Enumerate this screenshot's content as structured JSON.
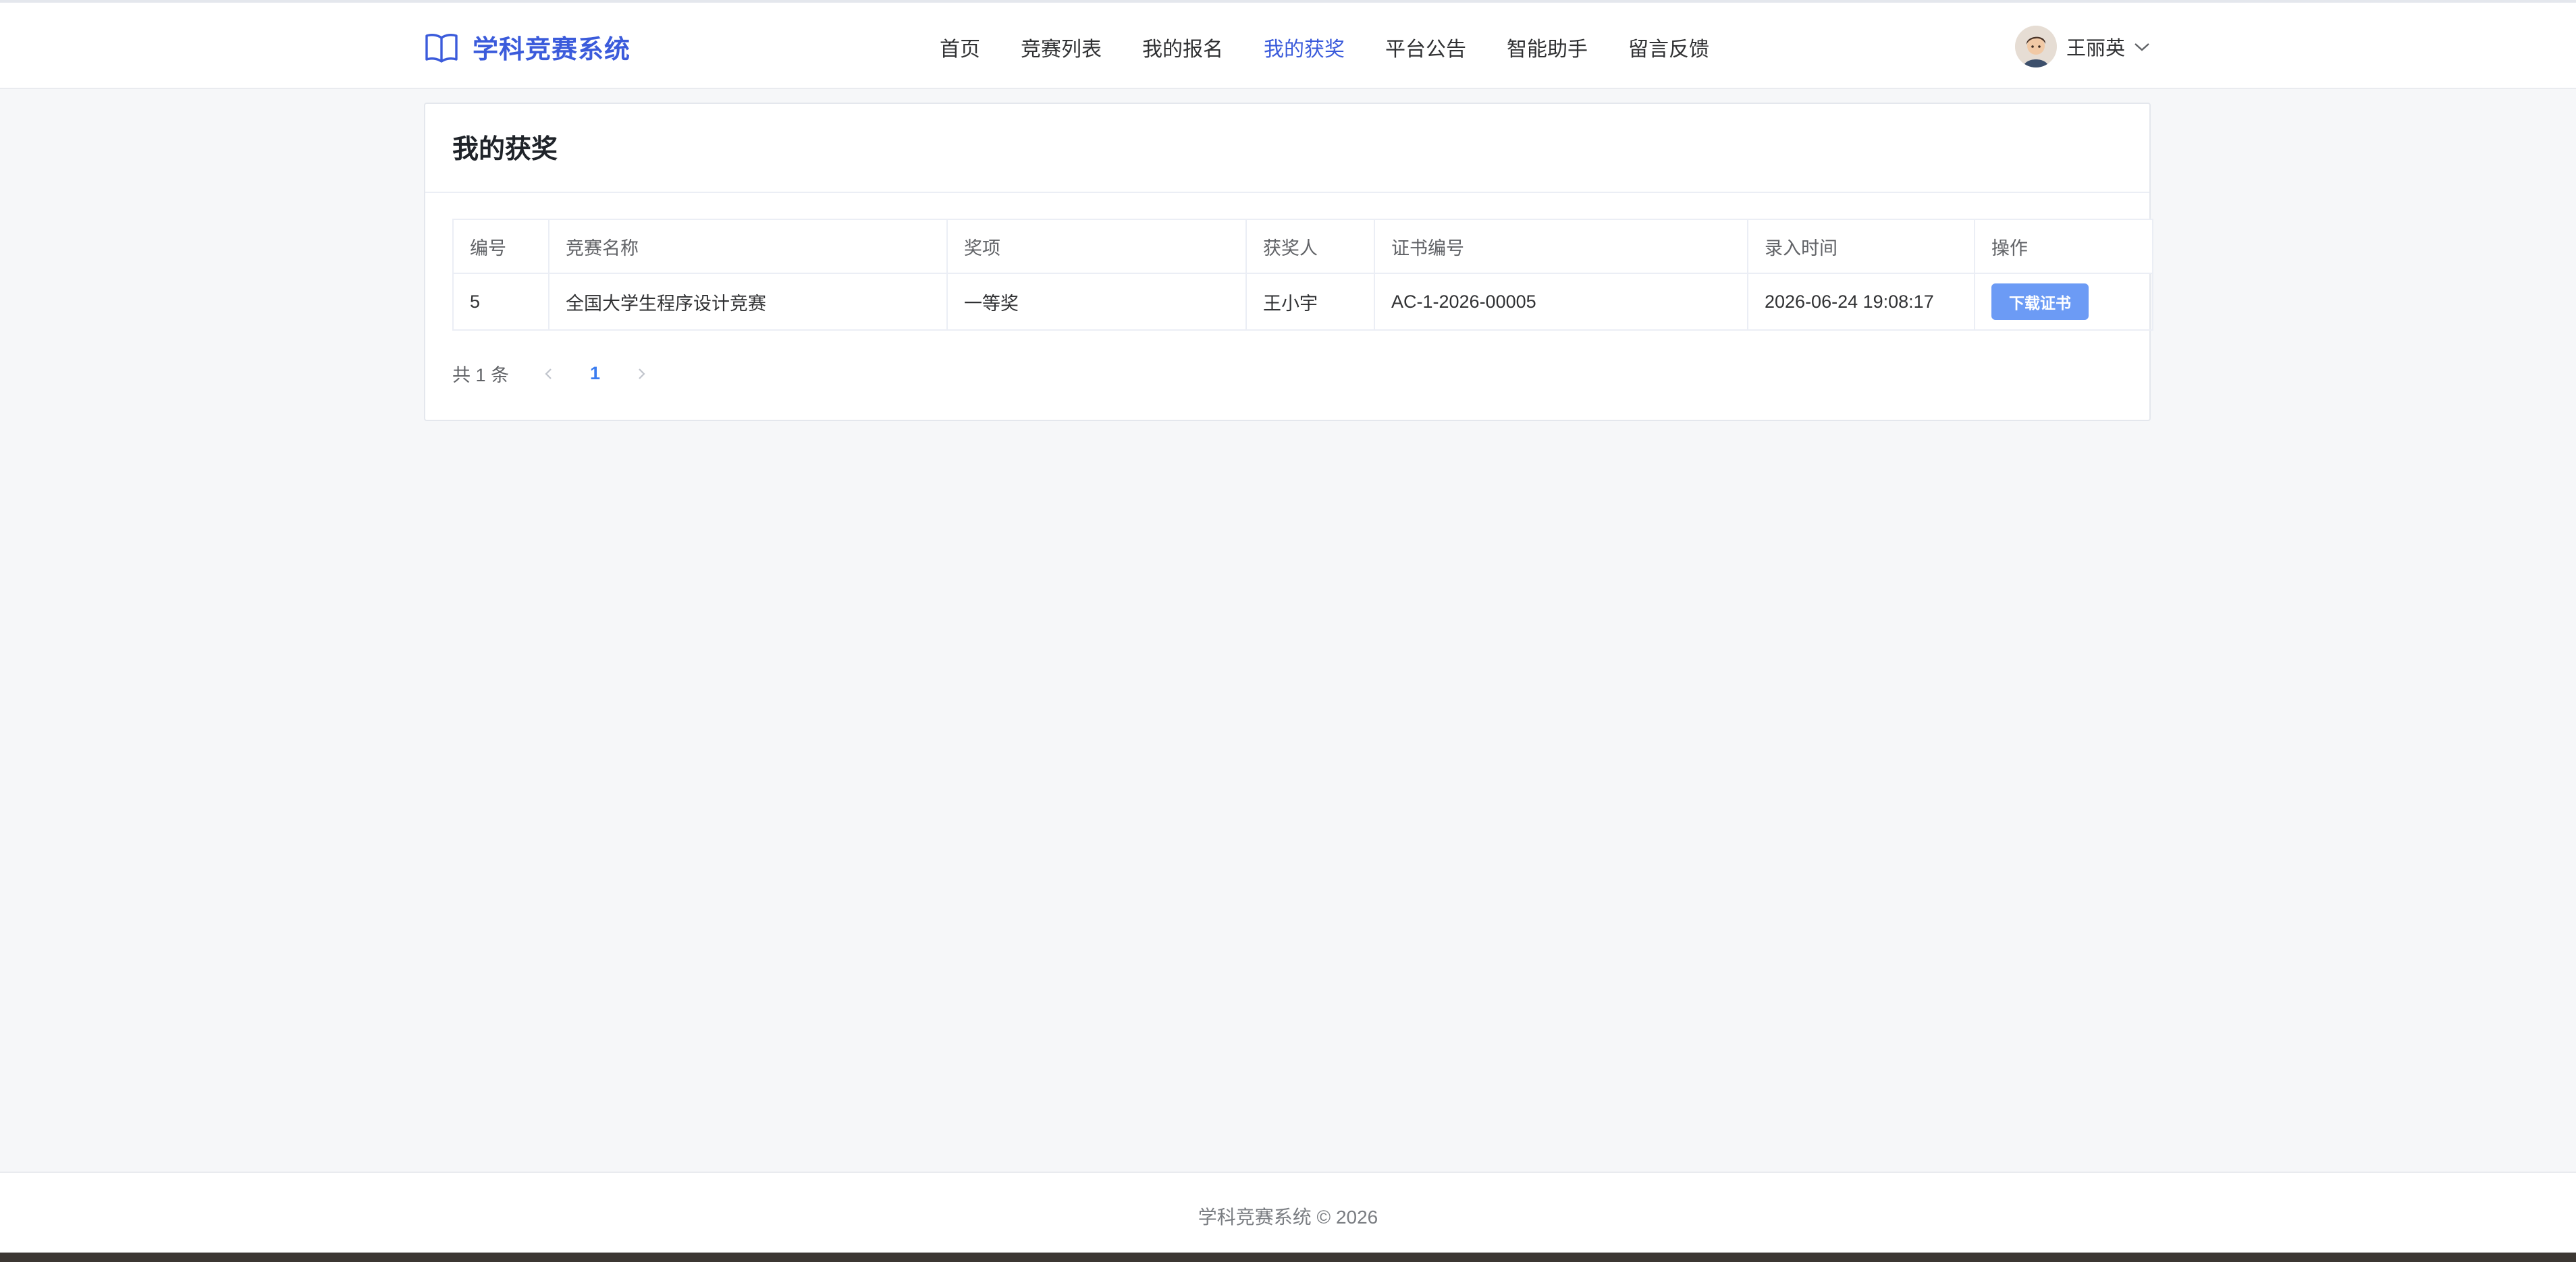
{
  "app": {
    "title": "学科竞赛系统"
  },
  "nav": {
    "items": [
      {
        "label": "首页"
      },
      {
        "label": "竞赛列表"
      },
      {
        "label": "我的报名"
      },
      {
        "label": "我的获奖"
      },
      {
        "label": "平台公告"
      },
      {
        "label": "智能助手"
      },
      {
        "label": "留言反馈"
      }
    ],
    "active_label": "我的获奖"
  },
  "user": {
    "name": "王丽英",
    "avatar_icon": "user-avatar",
    "menu_icon": "chevron-down-icon"
  },
  "page": {
    "title": "我的获奖"
  },
  "table": {
    "headers": {
      "id": "编号",
      "competition": "竞赛名称",
      "award": "奖项",
      "winner": "获奖人",
      "certificate_no": "证书编号",
      "entry_time": "录入时间",
      "actions": "操作"
    },
    "rows": [
      {
        "id": "5",
        "competition": "全国大学生程序设计竞赛",
        "award": "一等奖",
        "winner": "王小宇",
        "certificate_no": "AC-1-2026-00005",
        "entry_time": "2026-06-24 19:08:17",
        "action_label": "下载证书"
      }
    ]
  },
  "pagination": {
    "total_text": "共 1 条",
    "current_page": "1"
  },
  "footer": {
    "text": "学科竞赛系统 © 2026"
  },
  "colors": {
    "brand": "#3b5bdb",
    "button": "#6c9bf5",
    "page_active": "#3b7cf0"
  }
}
